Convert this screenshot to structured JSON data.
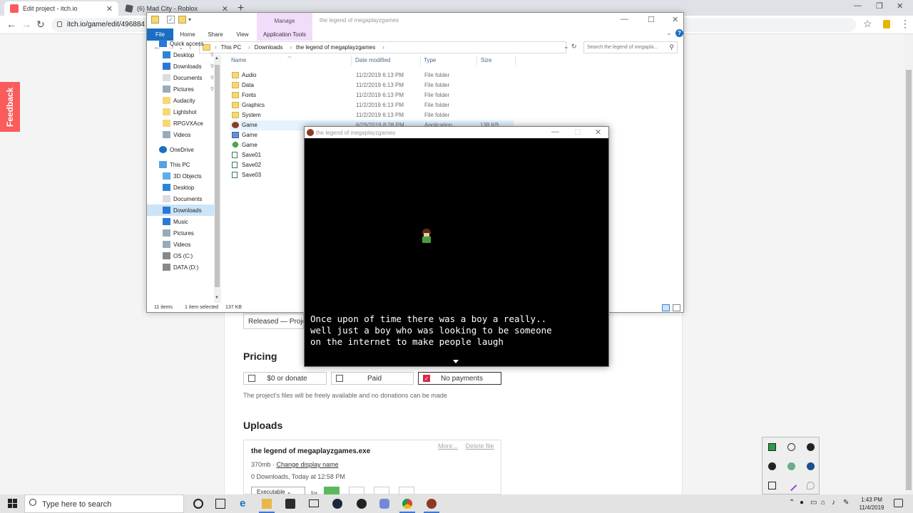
{
  "browser": {
    "tabs": [
      {
        "title": "Edit project - itch.io",
        "active": true
      },
      {
        "title": "(6) Mad City - Roblox",
        "active": false
      }
    ],
    "url": "itch.io/game/edit/496884",
    "accent": "#fa5c5c"
  },
  "itch": {
    "feedback_label": "Feedback",
    "released_text": "Released — Project is",
    "pricing_heading": "Pricing",
    "pricing_options": [
      {
        "label": "$0 or donate",
        "selected": false
      },
      {
        "label": "Paid",
        "selected": false
      },
      {
        "label": "No payments",
        "selected": true
      }
    ],
    "pricing_note": "The project's files will be freely available and no donations can be made",
    "uploads_heading": "Uploads",
    "upload": {
      "more": "More...",
      "delete": "Delete file",
      "filename": "the legend of megaplayzgames.exe",
      "size": "370mb",
      "change_name": "Change display name",
      "downloads": "0 Downloads, Today at 12:58 PM",
      "type_select": "Executable",
      "for_label": "for"
    }
  },
  "explorer": {
    "manage_label": "Manage",
    "window_title": "the legend of megaplayzgames",
    "ribbon_tabs": [
      "File",
      "Home",
      "Share",
      "View",
      "Application Tools"
    ],
    "breadcrumbs": [
      "This PC",
      "Downloads",
      "the legend of megaplayzgames"
    ],
    "search_placeholder": "Search the legend of megapla...",
    "nav": [
      {
        "label": "Quick access",
        "icon": "star-icon",
        "pinned": false
      },
      {
        "label": "Desktop",
        "icon": "desktop-icon",
        "pinned": true
      },
      {
        "label": "Downloads",
        "icon": "download-icon",
        "pinned": true
      },
      {
        "label": "Documents",
        "icon": "documents-icon",
        "pinned": true
      },
      {
        "label": "Pictures",
        "icon": "pictures-icon",
        "pinned": true
      },
      {
        "label": "Audacity",
        "icon": "folder-icon",
        "pinned": false
      },
      {
        "label": "Lightshot",
        "icon": "folder-icon",
        "pinned": false
      },
      {
        "label": "RPGVXAce",
        "icon": "folder-icon",
        "pinned": false
      },
      {
        "label": "Videos",
        "icon": "videos-icon",
        "pinned": false
      },
      {
        "label": "OneDrive",
        "icon": "onedrive-icon",
        "pinned": false
      },
      {
        "label": "This PC",
        "icon": "computer-icon",
        "pinned": false
      },
      {
        "label": "3D Objects",
        "icon": "cube-icon",
        "pinned": false
      },
      {
        "label": "Desktop",
        "icon": "desktop-icon",
        "pinned": false
      },
      {
        "label": "Documents",
        "icon": "documents-icon",
        "pinned": false
      },
      {
        "label": "Downloads",
        "icon": "download-icon",
        "pinned": false,
        "selected": true
      },
      {
        "label": "Music",
        "icon": "music-icon",
        "pinned": false
      },
      {
        "label": "Pictures",
        "icon": "pictures-icon",
        "pinned": false
      },
      {
        "label": "Videos",
        "icon": "videos-icon",
        "pinned": false
      },
      {
        "label": "OS (C:)",
        "icon": "drive-icon",
        "pinned": false
      },
      {
        "label": "DATA (D:)",
        "icon": "drive-icon",
        "pinned": false
      }
    ],
    "columns": [
      "Name",
      "Date modified",
      "Type",
      "Size"
    ],
    "files": [
      {
        "name": "Audio",
        "date": "11/2/2019 6:13 PM",
        "type": "File folder",
        "size": "",
        "icon": "folder"
      },
      {
        "name": "Data",
        "date": "11/2/2019 6:13 PM",
        "type": "File folder",
        "size": "",
        "icon": "folder"
      },
      {
        "name": "Fonts",
        "date": "11/2/2019 6:13 PM",
        "type": "File folder",
        "size": "",
        "icon": "folder"
      },
      {
        "name": "Graphics",
        "date": "11/2/2019 6:13 PM",
        "type": "File folder",
        "size": "",
        "icon": "folder"
      },
      {
        "name": "System",
        "date": "11/2/2019 6:13 PM",
        "type": "File folder",
        "size": "",
        "icon": "folder"
      },
      {
        "name": "Game",
        "date": "6/29/2019 8:28 PM",
        "type": "Application",
        "size": "138 KB",
        "icon": "app",
        "selected": true
      },
      {
        "name": "Game",
        "date": "",
        "type": "",
        "size": "",
        "icon": "app2"
      },
      {
        "name": "Game",
        "date": "",
        "type": "",
        "size": "",
        "icon": "gem"
      },
      {
        "name": "Save01",
        "date": "",
        "type": "",
        "size": "",
        "icon": "doc"
      },
      {
        "name": "Save02",
        "date": "",
        "type": "",
        "size": "",
        "icon": "doc"
      },
      {
        "name": "Save03",
        "date": "",
        "type": "",
        "size": "",
        "icon": "doc"
      }
    ],
    "status": {
      "items": "11 items",
      "selected": "1 item selected",
      "size": "137 KB"
    }
  },
  "game": {
    "title": "the legend of megaplayzgames",
    "dialogue": [
      "Once upon of time there was a boy a really..",
      "well just a boy who was looking to be someone",
      "on the internet to make people laugh"
    ]
  },
  "taskbar": {
    "search_placeholder": "Type here to search",
    "time": "1:43 PM",
    "date": "11/4/2019"
  }
}
